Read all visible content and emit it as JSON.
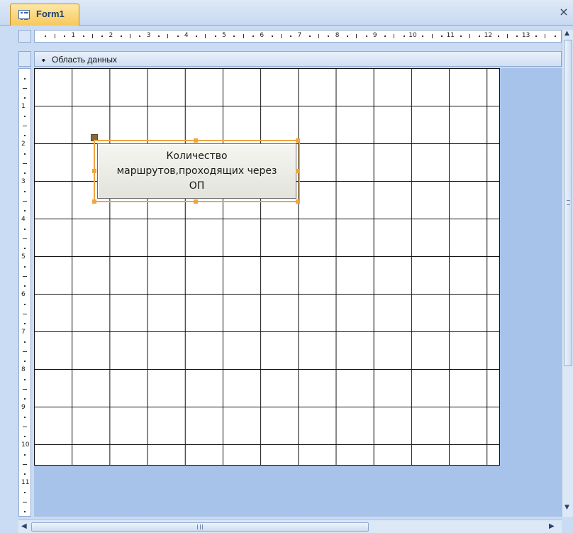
{
  "window": {
    "tab_title": "Form1",
    "close_symbol": "×"
  },
  "section": {
    "label": "Область данных",
    "icon": "arrow-down-icon"
  },
  "ruler": {
    "horizontal_numbers": [
      "1",
      "2",
      "3",
      "4",
      "5",
      "6",
      "7",
      "8",
      "9",
      "10",
      "11",
      "12",
      "13"
    ],
    "vertical_numbers": [
      "1",
      "2",
      "3",
      "4",
      "5",
      "6",
      "7",
      "8",
      "9",
      "10",
      "11"
    ]
  },
  "control": {
    "caption": "Количество\nмаршрутов,проходящих через\nОП",
    "selected": true
  },
  "colors": {
    "accent": "#f0a640",
    "workspace": "#a8c3ea",
    "tab": "#f8c85a"
  }
}
